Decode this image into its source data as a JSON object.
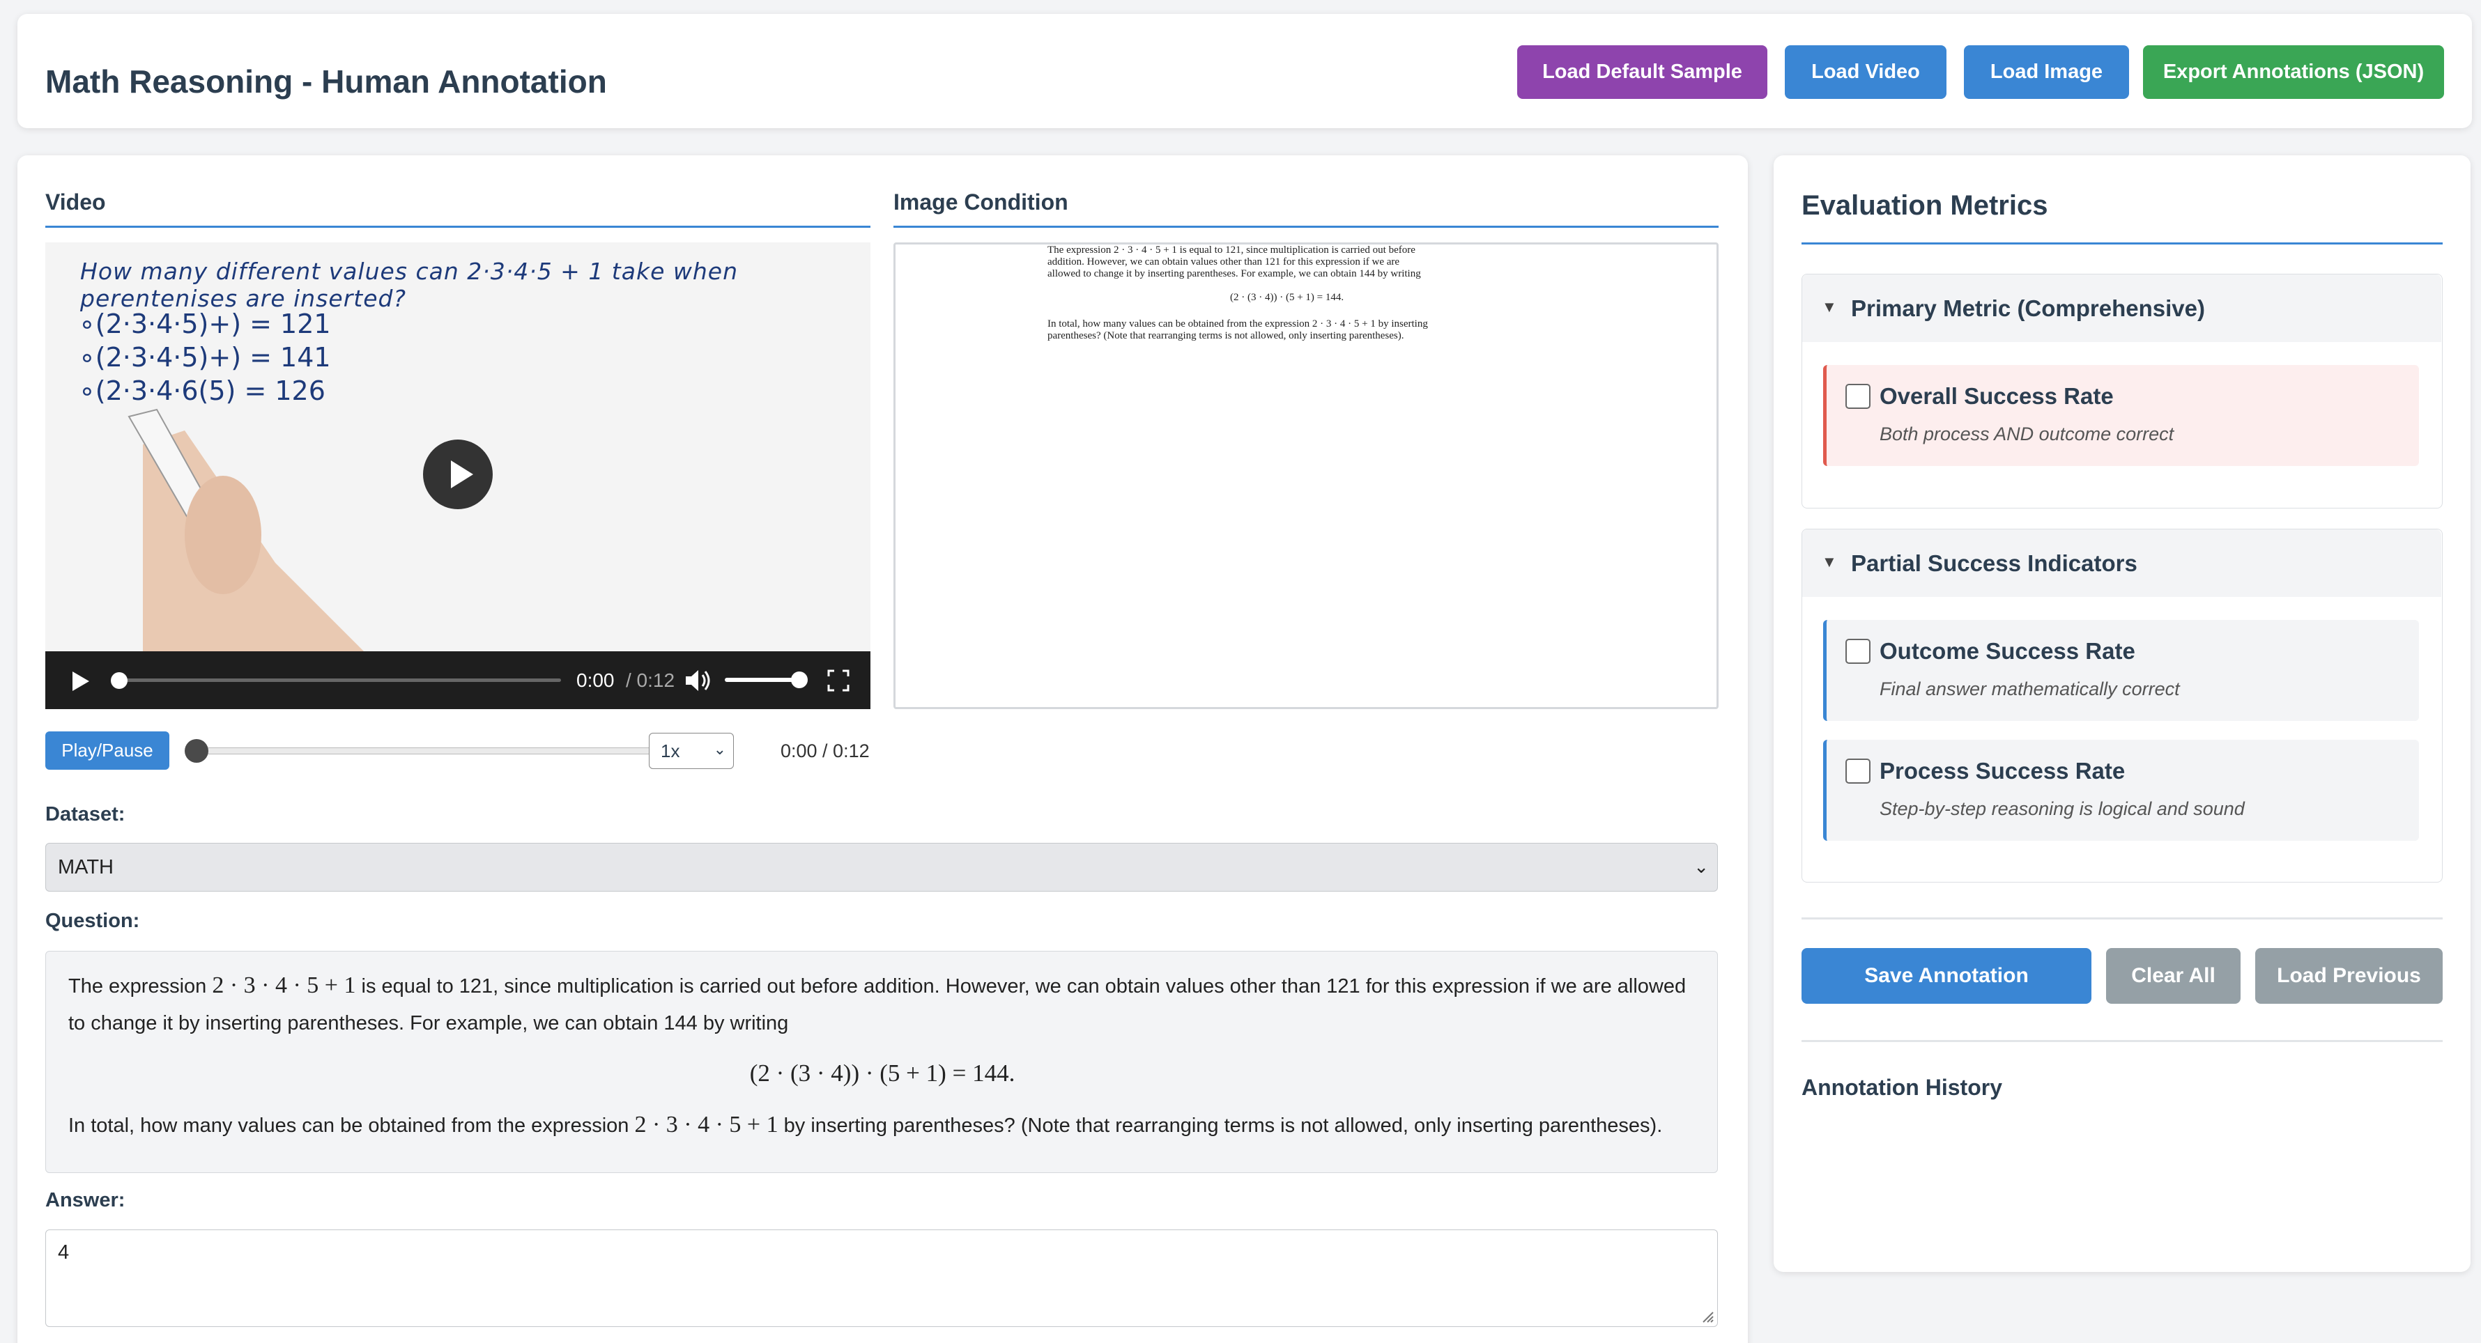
{
  "header": {
    "title": "Math Reasoning - Human Annotation",
    "buttons": {
      "load_default": "Load Default Sample",
      "load_video": "Load Video",
      "load_image": "Load Image",
      "export": "Export Annotations (JSON)"
    },
    "colors": {
      "purple": "#8e44ad",
      "blue": "#3a86d4",
      "green": "#3aa655"
    }
  },
  "video": {
    "section_title": "Video",
    "frame_title": "How many different values can 2·3·4·5 + 1 take when perentenises are inserted?",
    "frame_lines": [
      "∘(2·3·4·5)+) = 121",
      "∘(2·3·4·5)+) = 141",
      "∘(2·3·4·6(5) = 126"
    ],
    "current_time": "0:00",
    "duration": "/ 0:12"
  },
  "image_condition": {
    "section_title": "Image Condition",
    "lines": [
      "The expression 2 · 3 · 4 · 5 + 1 is equal to 121, since multiplication is carried out before",
      "addition.  However, we can obtain values other than 121 for this expression if we are",
      "allowed to change it by inserting parentheses.  For example, we can obtain 144 by writing",
      "(2 · (3 · 4)) · (5 + 1) = 144.",
      "In total, how many values can be obtained from the expression 2 · 3 · 4 · 5 + 1 by inserting",
      "parentheses?  (Note that rearranging terms is not allowed, only inserting parentheses)."
    ]
  },
  "controls": {
    "play_pause": "Play/Pause",
    "speed": "1x",
    "time": "0:00 / 0:12"
  },
  "dataset": {
    "label": "Dataset:",
    "value": "MATH"
  },
  "question": {
    "label": "Question:",
    "line1_a": "The expression ",
    "line1_math": "2 · 3 · 4 · 5 + 1",
    "line1_b": " is equal to 121, since multiplication is carried out before addition. However, we can obtain values other than 121 for this expression if we are allowed",
    "line2": "to change it by inserting parentheses. For example, we can obtain 144 by writing",
    "equation": "(2 · (3 · 4)) · (5 + 1) = 144.",
    "line3_a": "In total, how many values can be obtained from the expression ",
    "line3_math": "2 · 3 · 4 · 5 + 1",
    "line3_b": " by inserting parentheses? (Note that rearranging terms is not allowed, only inserting parentheses)."
  },
  "answer": {
    "label": "Answer:",
    "value": "4"
  },
  "metrics": {
    "title": "Evaluation Metrics",
    "primary": {
      "title": "Primary Metric (Comprehensive)",
      "items": [
        {
          "title": "Overall Success Rate",
          "desc": "Both process AND outcome correct",
          "checked": false
        }
      ]
    },
    "partial": {
      "title": "Partial Success Indicators",
      "items": [
        {
          "title": "Outcome Success Rate",
          "desc": "Final answer mathematically correct",
          "checked": false
        },
        {
          "title": "Process Success Rate",
          "desc": "Step-by-step reasoning is logical and sound",
          "checked": false
        }
      ]
    },
    "accent_red": "#e05a4e",
    "accent_blue": "#3a86d4"
  },
  "actions": {
    "save": "Save Annotation",
    "clear": "Clear All",
    "load_previous": "Load Previous"
  },
  "history": {
    "title": "Annotation History"
  }
}
